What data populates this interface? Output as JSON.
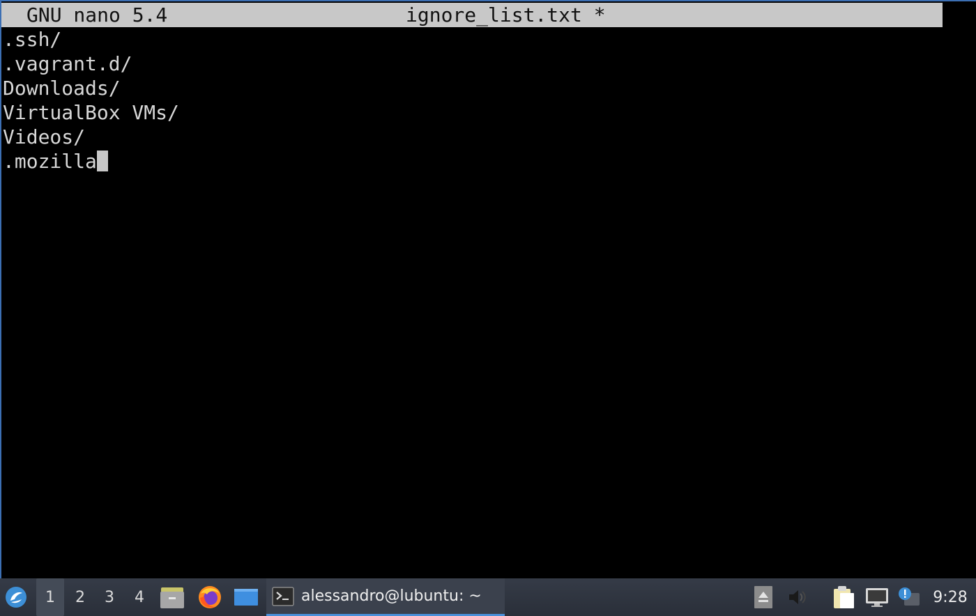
{
  "nano": {
    "version": "GNU nano 5.4",
    "filename": "ignore_list.txt *"
  },
  "editor": {
    "lines": [
      ".ssh/",
      ".vagrant.d/",
      "Downloads/",
      "VirtualBox VMs/",
      "Videos/",
      ".mozilla"
    ]
  },
  "taskbar": {
    "start_icon": "lubuntu-logo-icon",
    "desktops": [
      "1",
      "2",
      "3",
      "4"
    ],
    "active_desktop": "1",
    "quicklaunch": [
      "file-manager-icon",
      "firefox-icon",
      "desktop-icon"
    ],
    "task": {
      "icon": "terminal-icon",
      "label": "alessandro@lubuntu: ~"
    },
    "tray": [
      "eject-icon",
      "volume-icon",
      "clipboard-icon",
      "network-icon",
      "notification-icon"
    ],
    "clock": "9:28"
  },
  "colors": {
    "header_bg": "#c8c8c8",
    "taskbar_bg": "#2e3440",
    "accent": "#4a90d9"
  }
}
